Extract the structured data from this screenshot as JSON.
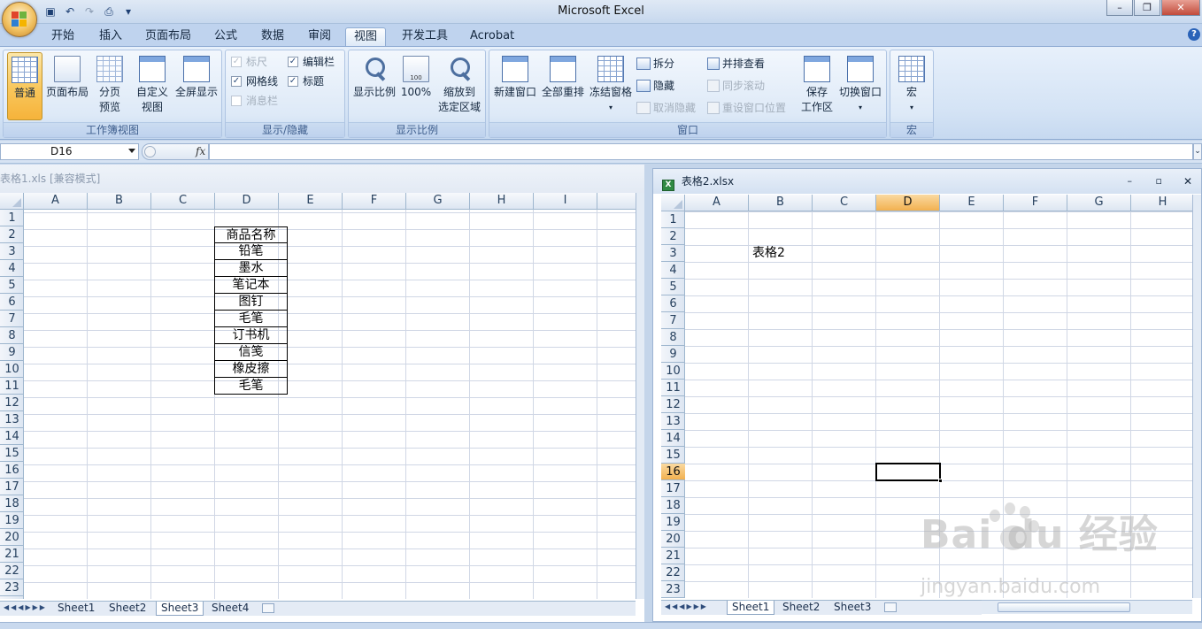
{
  "app": {
    "title": "Microsoft Excel"
  },
  "qat": {
    "icons": [
      "save-icon",
      "undo-icon",
      "redo-icon",
      "print-preview-icon",
      "customize-icon"
    ]
  },
  "tabs": [
    "开始",
    "插入",
    "页面布局",
    "公式",
    "数据",
    "审阅",
    "视图",
    "开发工具",
    "Acrobat"
  ],
  "active_tab": "视图",
  "ribbon": {
    "workbook_views": {
      "label": "工作簿视图",
      "normal": "普通",
      "page_layout": "页面布局",
      "page_break_1": "分页",
      "page_break_2": "预览",
      "custom_1": "自定义",
      "custom_2": "视图",
      "fullscreen": "全屏显示"
    },
    "show_hide": {
      "label": "显示/隐藏",
      "ruler": "标尺",
      "gridlines": "网格线",
      "message_bar": "消息栏",
      "formula_bar": "编辑栏",
      "headings": "标题",
      "ruler_checked": true,
      "gridlines_checked": true,
      "message_bar_checked": false,
      "formula_bar_checked": true,
      "headings_checked": true
    },
    "zoom": {
      "label": "显示比例",
      "zoom": "显示比例",
      "hundred": "100%",
      "fit_1": "缩放到",
      "fit_2": "选定区域",
      "hundred_icon_text": "100"
    },
    "window": {
      "label": "窗口",
      "new_window": "新建窗口",
      "arrange_all": "全部重排",
      "freeze_panes": "冻结窗格",
      "split": "拆分",
      "hide": "隐藏",
      "unhide": "取消隐藏",
      "side_by_side": "并排查看",
      "sync_scroll": "同步滚动",
      "reset_position": "重设窗口位置",
      "save_ws_1": "保存",
      "save_ws_2": "工作区",
      "switch_windows": "切换窗口"
    },
    "macros": {
      "label": "宏",
      "macros": "宏"
    }
  },
  "formula_bar": {
    "name_box": "D16",
    "fx": "fx",
    "value": ""
  },
  "left_window": {
    "title": "表格1.xls  [兼容模式]",
    "columns": [
      "A",
      "B",
      "C",
      "D",
      "E",
      "F",
      "G",
      "H",
      "I"
    ],
    "rows": [
      "1",
      "2",
      "3",
      "4",
      "5",
      "6",
      "7",
      "8",
      "9",
      "10",
      "11",
      "12",
      "13",
      "14",
      "15",
      "16",
      "17",
      "18",
      "19",
      "20",
      "21",
      "22",
      "23"
    ],
    "column_d_values": [
      "商品名称",
      "铅笔",
      "墨水",
      "笔记本",
      "图钉",
      "毛笔",
      "订书机",
      "信笺",
      "橡皮擦",
      "毛笔"
    ],
    "sheets": [
      "Sheet1",
      "Sheet2",
      "Sheet3",
      "Sheet4"
    ],
    "active_sheet": "Sheet3"
  },
  "right_window": {
    "title": "表格2.xlsx",
    "columns": [
      "A",
      "B",
      "C",
      "D",
      "E",
      "F",
      "G",
      "H"
    ],
    "rows": [
      "1",
      "2",
      "3",
      "4",
      "5",
      "6",
      "7",
      "8",
      "9",
      "10",
      "11",
      "12",
      "13",
      "14",
      "15",
      "16",
      "17",
      "18",
      "19",
      "20",
      "21",
      "22",
      "23"
    ],
    "cell_b3": "表格2",
    "selected_column": "D",
    "selected_row": "16",
    "sheets": [
      "Sheet1",
      "Sheet2",
      "Sheet3"
    ],
    "active_sheet": "Sheet1"
  },
  "watermark": {
    "main": "Bai du 经验",
    "sub": "jingyan.baidu.com"
  }
}
